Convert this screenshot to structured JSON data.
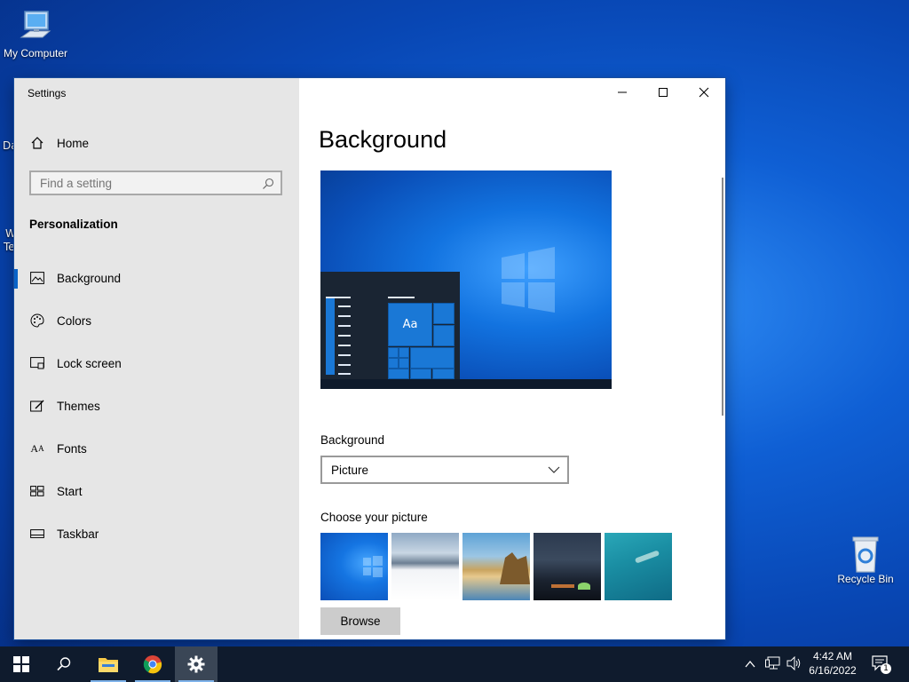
{
  "desktop": {
    "icons": [
      {
        "label": "My Computer"
      },
      {
        "label": "Recycle Bin"
      }
    ],
    "partial_labels": [
      "Da",
      "W",
      "Te"
    ]
  },
  "window": {
    "title": "Settings",
    "controls": {
      "minimize": "minimize-icon",
      "maximize": "maximize-icon",
      "close": "close-icon"
    }
  },
  "sidebar": {
    "home_label": "Home",
    "search_placeholder": "Find a setting",
    "section_title": "Personalization",
    "items": [
      {
        "label": "Background",
        "icon": "picture-icon",
        "active": true
      },
      {
        "label": "Colors",
        "icon": "palette-icon"
      },
      {
        "label": "Lock screen",
        "icon": "lock-screen-icon"
      },
      {
        "label": "Themes",
        "icon": "themes-icon"
      },
      {
        "label": "Fonts",
        "icon": "fonts-icon"
      },
      {
        "label": "Start",
        "icon": "start-icon"
      },
      {
        "label": "Taskbar",
        "icon": "taskbar-icon"
      }
    ]
  },
  "main": {
    "page_title": "Background",
    "preview_tile_text": "Aa",
    "background_label": "Background",
    "background_selected": "Picture",
    "choose_picture_label": "Choose your picture",
    "browse_label": "Browse"
  },
  "taskbar": {
    "time": "4:42 AM",
    "date": "6/16/2022",
    "notification_count": "1"
  },
  "colors": {
    "accent": "#0a64c8",
    "sidebar_bg": "#e6e6e6",
    "taskbar_bg": "#0f1b2d"
  }
}
